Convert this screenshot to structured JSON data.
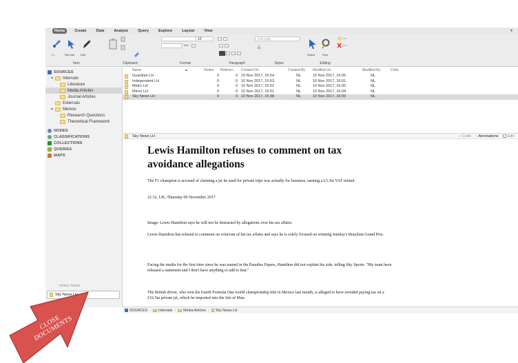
{
  "menubar": {
    "tabs": [
      "Home",
      "Create",
      "Data",
      "Analyze",
      "Query",
      "Explore",
      "Layout",
      "View"
    ],
    "active": "Home"
  },
  "ribbon": {
    "groups": [
      "Item",
      "Clipboard",
      "Format",
      "Paragraph",
      "Styles",
      "Editing"
    ],
    "item_buttons": [
      "Get Info",
      "Edit"
    ],
    "style_field": "Text body",
    "font_size": "12",
    "text_label": "Text",
    "editing_buttons": [
      "Select",
      "Find"
    ]
  },
  "sidebar": {
    "items": [
      {
        "label": "SOURCES",
        "level": 0,
        "type": "section",
        "icon": "sources-icon"
      },
      {
        "label": "Internals",
        "level": 1,
        "type": "folder-open"
      },
      {
        "label": "Literature",
        "level": 2,
        "type": "folder"
      },
      {
        "label": "Media Articles",
        "level": 2,
        "type": "folder",
        "selected": true
      },
      {
        "label": "Journal Articles",
        "level": 2,
        "type": "folder"
      },
      {
        "label": "Externals",
        "level": 1,
        "type": "folder"
      },
      {
        "label": "Memos",
        "level": 1,
        "type": "folder-open"
      },
      {
        "label": "Research Questions",
        "level": 2,
        "type": "folder"
      },
      {
        "label": "Theoretical Framework",
        "level": 2,
        "type": "folder"
      },
      {
        "label": "NODES",
        "level": 0,
        "type": "section",
        "icon": "nodes-icon"
      },
      {
        "label": "CLASSIFICATIONS",
        "level": 0,
        "type": "section",
        "icon": "classifications-icon"
      },
      {
        "label": "COLLECTIONS",
        "level": 0,
        "type": "section",
        "icon": "collections-icon"
      },
      {
        "label": "QUERIES",
        "level": 0,
        "type": "section",
        "icon": "queries-icon"
      },
      {
        "label": "MAPS",
        "level": 0,
        "type": "section",
        "icon": "maps-icon"
      }
    ],
    "open_items_label": "OPEN ITEMS",
    "open_doc": "Sky News LH"
  },
  "list": {
    "columns": [
      "Name",
      "Nodes",
      "Referen...",
      "Created On",
      "Created By",
      "Modified On",
      "Modified By",
      "Color"
    ],
    "rows": [
      {
        "name": "Guardian LH",
        "nodes": "0",
        "refs": "0",
        "created_on": "10 Nov 2017, 15:54",
        "created_by": "NL",
        "modified_on": "10 Nov 2017, 16:05",
        "modified_by": "NL"
      },
      {
        "name": "Independent LH",
        "nodes": "0",
        "refs": "0",
        "created_on": "10 Nov 2017, 15:53",
        "created_by": "NL",
        "modified_on": "10 Nov 2017, 16:01",
        "modified_by": "NL"
      },
      {
        "name": "Metro LH",
        "nodes": "0",
        "refs": "0",
        "created_on": "10 Nov 2017, 15:52",
        "created_by": "NL",
        "modified_on": "10 Nov 2017, 16:00",
        "modified_by": "NL"
      },
      {
        "name": "Mirror LH",
        "nodes": "0",
        "refs": "0",
        "created_on": "10 Nov 2017, 15:51",
        "created_by": "NL",
        "modified_on": "10 Nov 2017, 16:04",
        "modified_by": "NL"
      },
      {
        "name": "Sky News LH",
        "nodes": "0",
        "refs": "0",
        "created_on": "10 Nov 2017, 15:38",
        "created_by": "NL",
        "modified_on": "10 Nov 2017, 16:06",
        "modified_by": "NL",
        "selected": true
      }
    ]
  },
  "detail": {
    "title": "Sky News LH",
    "code_label": "Code",
    "annotations_label": "Annotations",
    "edit_label": "Edit"
  },
  "document": {
    "headline": "Lewis Hamilton refuses to comment on tax avoidance allegations",
    "paragraphs": [
      "The F1 champion is accused of claiming a jet he used for private trips was actually for business, earning a £3.3m VAT refund.",
      "21:32, UK, Thursday 09 November 2017",
      "Image: Lewis Hamilton says he will not be distracted by allegations over his tax affairs.",
      "Lewis Hamilton has refused to comment on criticism of his tax affairs and says he is solely focused on winning Sunday's Brazilian Grand Prix.",
      "Facing the media for the first time since he was named in the Paradise Papers, Hamilton did not explain his side, telling Sky Sports: \"My team have released a statement and I don't have anything to add to that.\"",
      "The British driver, who won his fourth Formula One world championship title in Mexico last month, is alleged to have avoided paying tax on a £16.5m private jet, which he imported into the Isle of Man."
    ]
  },
  "breadcrumb": [
    "SOURCES",
    "Internals",
    "Media Articles",
    "Sky News LH"
  ],
  "callout": {
    "text_line1": "CLOSE",
    "text_line2": "DOCUMENTS",
    "color": "#d9524e"
  }
}
